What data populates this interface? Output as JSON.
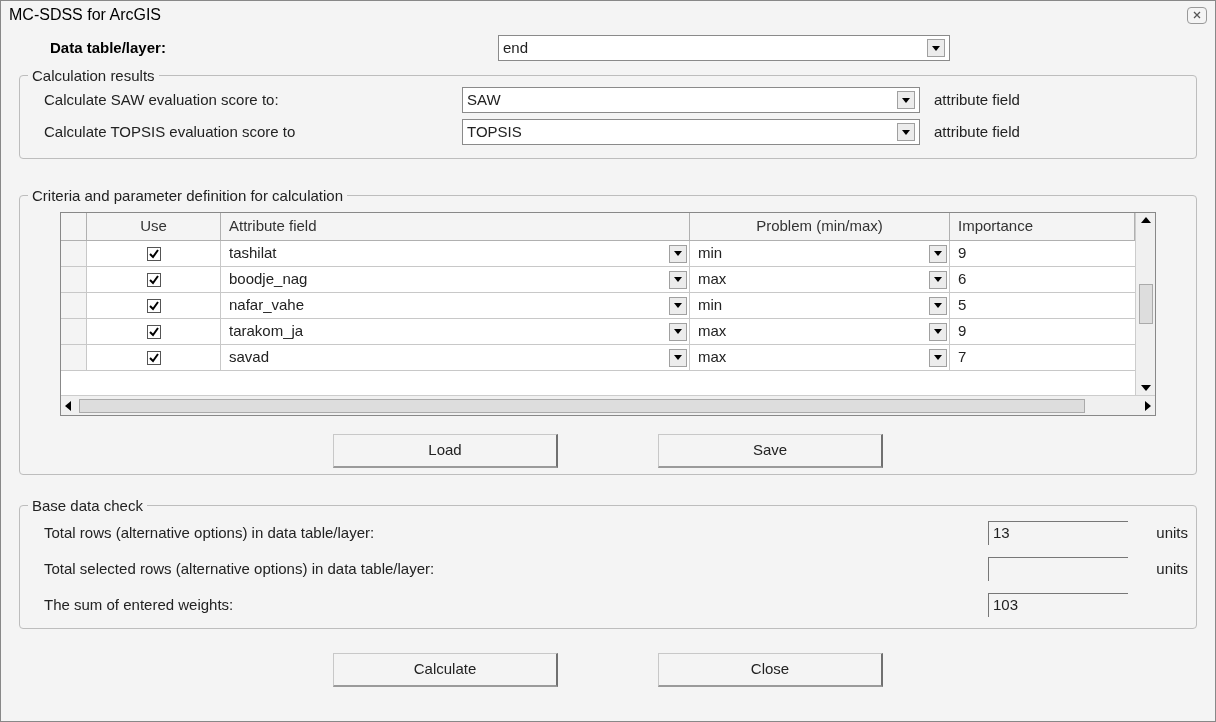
{
  "window": {
    "title": "MC-SDSS for ArcGIS"
  },
  "data_table": {
    "label": "Data table/layer:",
    "value": "end"
  },
  "calculation_results": {
    "title": "Calculation results",
    "rows": [
      {
        "label": "Calculate SAW evaluation score to:",
        "value": "SAW",
        "suffix": "attribute field"
      },
      {
        "label": "Calculate TOPSIS evaluation score to",
        "value": "TOPSIS",
        "suffix": "attribute field"
      }
    ]
  },
  "criteria": {
    "title": "Criteria and parameter definition for calculation",
    "columns": [
      "Use",
      "Attribute field",
      "Problem (min/max)",
      "Importance"
    ],
    "rows": [
      {
        "checked": true,
        "attribute": "tashilat",
        "problem": "min",
        "importance": "9"
      },
      {
        "checked": true,
        "attribute": "boodje_nag",
        "problem": "max",
        "importance": "6"
      },
      {
        "checked": true,
        "attribute": "nafar_vahe",
        "problem": "min",
        "importance": "5"
      },
      {
        "checked": true,
        "attribute": "tarakom_ja",
        "problem": "max",
        "importance": "9"
      },
      {
        "checked": true,
        "attribute": "savad",
        "problem": "max",
        "importance": "7"
      }
    ]
  },
  "file_buttons": [
    "Load",
    "Save"
  ],
  "base_data_check": {
    "title": "Base data check",
    "rows": [
      {
        "label": "Total rows (alternative options) in data table/layer:",
        "value": "13",
        "unit": "units"
      },
      {
        "label": "Total selected rows (alternative options) in data table/layer:",
        "unit": "units"
      },
      {
        "label": "The sum of entered weights:",
        "value": "103"
      }
    ]
  },
  "buttons": [
    "Calculate",
    "Close"
  ]
}
